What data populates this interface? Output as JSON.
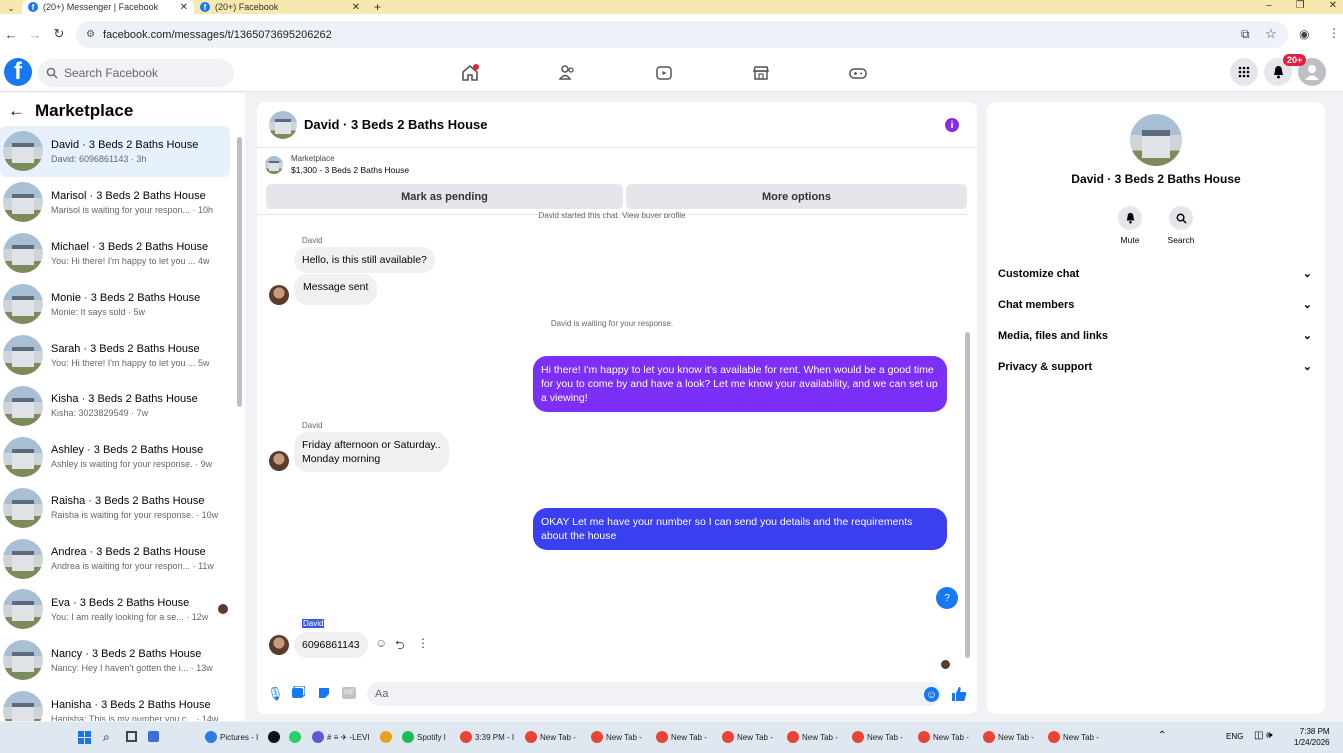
{
  "browser": {
    "tabs": [
      {
        "title": "(20+) Messenger | Facebook",
        "close": "✕"
      },
      {
        "title": "(20+) Facebook",
        "close": "✕"
      }
    ],
    "new_tab": "+",
    "url": "facebook.com/messages/t/1365073695206262",
    "window_controls": [
      "–",
      "❐",
      "✕"
    ]
  },
  "fb_header": {
    "logo": "f",
    "search_placeholder": "Search Facebook",
    "nav_icons": [
      "home-icon",
      "friends-icon",
      "video-icon",
      "marketplace-icon",
      "gaming-icon"
    ],
    "notifications_badge": "20+"
  },
  "sidebar": {
    "title": "Marketplace",
    "conversations": [
      {
        "name": "David · 3 Beds 2 Baths House",
        "preview": "David: 6096861143 · 3h"
      },
      {
        "name": "Marisol · 3 Beds 2 Baths House",
        "preview": "Marisol is waiting for your respon... · 10h"
      },
      {
        "name": "Michael · 3 Beds 2 Baths House",
        "preview": "You: Hi there! I'm happy to let you ...  4w"
      },
      {
        "name": "Monie · 3 Beds 2 Baths House",
        "preview": "Monie: It says sold · 5w"
      },
      {
        "name": "Sarah · 3 Beds 2 Baths House",
        "preview": "You: Hi there! I'm happy to let you ...  5w"
      },
      {
        "name": "Kisha · 3 Beds 2 Baths House",
        "preview": "Kisha: 3023829549 · 7w"
      },
      {
        "name": "Ashley · 3 Beds 2 Baths House",
        "preview": "Ashley is waiting for your response. · 9w"
      },
      {
        "name": "Raisha · 3 Beds 2 Baths House",
        "preview": "Raisha is waiting for your response. · 10w"
      },
      {
        "name": "Andrea · 3 Beds 2 Baths House",
        "preview": "Andrea is waiting for your respon... · 11w"
      },
      {
        "name": "Eva · 3 Beds 2 Baths House",
        "preview": "You: I am really looking for a se... · 12w"
      },
      {
        "name": "Nancy · 3 Beds 2 Baths House",
        "preview": "Nancy: Hey I haven't gotten the i... · 13w"
      },
      {
        "name": "Hanisha · 3 Beds 2 Baths House",
        "preview": "Hanisha: This is my number you c... · 14w"
      }
    ]
  },
  "chat": {
    "title": "David · 3 Beds 2 Baths House",
    "info": "i",
    "marketplace_label": "Marketplace",
    "listing": "$1,300 - 3 Beds 2 Baths House",
    "mark_pending": "Mark as pending",
    "more_options": "More options",
    "top_partial": "David started this chat. View buyer profile",
    "sender1": "David",
    "msg1": "Hello, is this still available?",
    "msg2": "Message sent",
    "waiting": "David is waiting for your response.",
    "out1": "Hi there! I'm happy to let you know it's available for rent. When would be a good time for you to come by and have a look? Let me know your availability, and we can set up a viewing!",
    "sender2": "David",
    "msg3_line1": "Friday afternoon or Saturday..",
    "msg3_line2": "Monday morning",
    "out2": "OKAY Let me have your number so I can send you details and the requirements about the house",
    "help": "?",
    "sender3": "David",
    "msg4": "6096861143",
    "composer_placeholder": "Aa"
  },
  "details": {
    "name": "David · 3 Beds 2 Baths House",
    "mute": "Mute",
    "search": "Search",
    "sections": [
      "Customize chat",
      "Chat members",
      "Media, files and links",
      "Privacy & support"
    ]
  },
  "taskbar": {
    "items": [
      "Pictures - I",
      "⠀",
      "⠀",
      "# ≡ ✈ -LEVI",
      "⠀",
      "Spotify I",
      "3:39 PM - I",
      "New Tab -",
      "New Tab -",
      "New Tab -",
      "New Tab -",
      "New Tab -",
      "New Tab -",
      "New Tab -",
      "New Tab -",
      "New Tab -"
    ],
    "lang": "ENG",
    "time": "7:38 PM",
    "date": "1/24/2026"
  },
  "colors": {
    "fb_blue": "#1877f2",
    "out_bubble_1": "#7b2ff7",
    "out_bubble_2": "#3a3ff0",
    "info": "#8a2be2"
  }
}
